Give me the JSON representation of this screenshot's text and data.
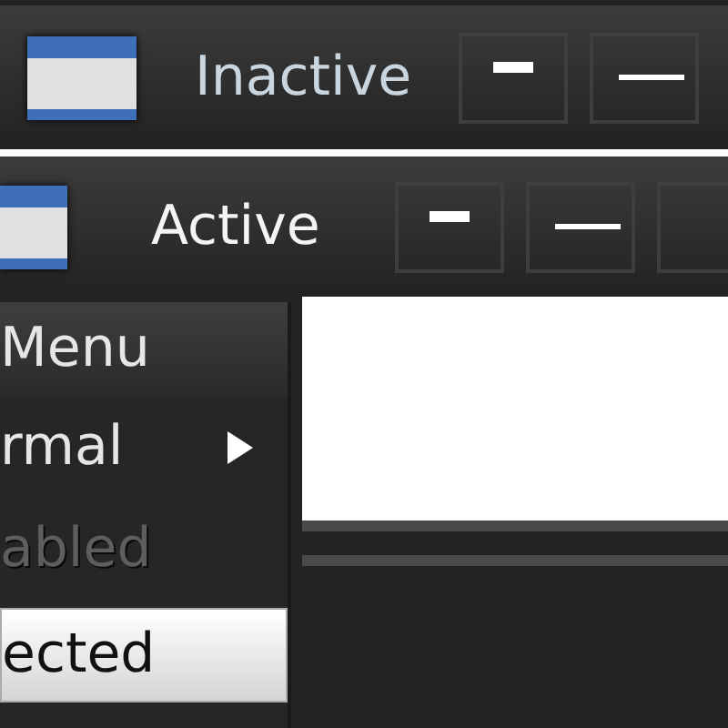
{
  "windows": [
    {
      "title": "Inactive",
      "active": false,
      "buttons": [
        {
          "kind": "shade"
        },
        {
          "kind": "minimize"
        }
      ]
    },
    {
      "title": "Active",
      "active": true,
      "buttons": [
        {
          "kind": "shade"
        },
        {
          "kind": "minimize"
        },
        {
          "kind": "other"
        }
      ]
    }
  ],
  "menu": {
    "title": "Menu",
    "items": [
      {
        "label": "rmal",
        "submenu": true,
        "disabled": false,
        "selected": false
      },
      {
        "label": "abled",
        "submenu": false,
        "disabled": true,
        "selected": false
      },
      {
        "label": "ected",
        "submenu": false,
        "disabled": false,
        "selected": true
      }
    ]
  }
}
